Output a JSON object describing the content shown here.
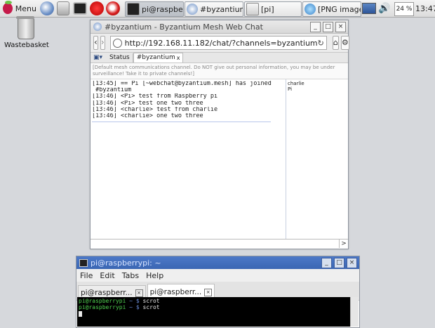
{
  "taskbar": {
    "menu_label": "Menu",
    "launchers": [
      "raspberry-icon",
      "globe-icon",
      "file-manager-icon",
      "terminal-icon",
      "mathematica-icon",
      "wolfram-icon"
    ],
    "tasks": [
      {
        "label": "pi@raspberr...",
        "icon": "terminal-icon",
        "active": true
      },
      {
        "label": "#byzantium ...",
        "icon": "browser-icon",
        "active": false
      },
      {
        "label": "[pi]",
        "icon": "folder-icon",
        "active": false
      },
      {
        "label": "[PNG image ...",
        "icon": "image-viewer-icon",
        "active": false
      }
    ],
    "cpu": "24 %",
    "clock": "13:47"
  },
  "desktop": {
    "trash_label": "Wastebasket"
  },
  "browser": {
    "title": "#byzantium - Byzantium Mesh Web Chat",
    "url": "http://192.168.11.182/chat/?channels=byzantium",
    "chat_tabs": {
      "status": "Status",
      "channel": "#byzantium"
    },
    "topic": "[Default mesh communications channel.  Do NOT give out personal information, you may be under surveillance!  Take it to private channels!]",
    "log": [
      "[13:45] == Pi [~webchat@byzantium.mesh] has joined",
      " #byzantium",
      "[13:46] <Pi> test from Raspberry pi",
      "[13:46] <Pi> test one two three",
      "[13:46] <charlie> test from charlie",
      "[13:46] <charlie> one two three"
    ],
    "nicks": [
      "charlie",
      "Pi"
    ],
    "send_glyph": ">"
  },
  "terminal": {
    "title": "pi@raspberrypi: ~",
    "menu": [
      "File",
      "Edit",
      "Tabs",
      "Help"
    ],
    "tabs": [
      "pi@raspberr...",
      "pi@raspberr..."
    ],
    "lines": [
      {
        "prompt": "pi@raspberrypi",
        "sep": " ~ $ ",
        "cmd": "scrot"
      },
      {
        "prompt": "pi@raspberrypi",
        "sep": " ~ $ ",
        "cmd": "scrot"
      }
    ]
  }
}
